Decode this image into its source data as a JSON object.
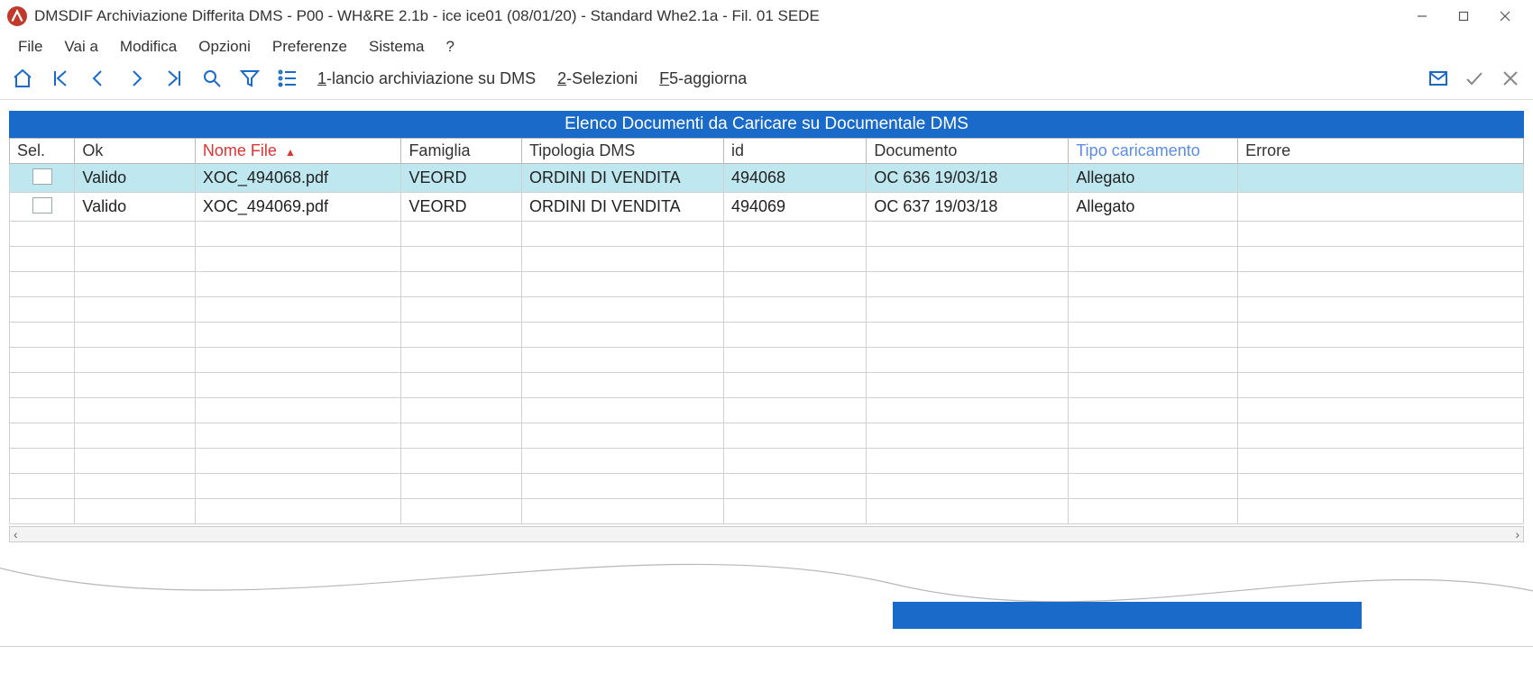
{
  "window": {
    "title": "DMSDIF  Archiviazione Differita DMS -  P00 - WH&RE  2.1b - ice  ice01 (08/01/20) - Standard Whe2.1a - Fil. 01 SEDE"
  },
  "menu": {
    "items": [
      "File",
      "Vai a",
      "Modifica",
      "Opzioni",
      "Preferenze",
      "Sistema",
      "?"
    ]
  },
  "toolbar": {
    "action1_prefix": "1",
    "action1_rest": "-lancio archiviazione su DMS",
    "action2_prefix": "2",
    "action2_rest": "-Selezioni",
    "action3_prefix": "F",
    "action3_rest": "5-aggiorna"
  },
  "panel": {
    "title": "Elenco Documenti da Caricare su Documentale DMS"
  },
  "table": {
    "headers": {
      "sel": "Sel.",
      "ok": "Ok",
      "nome_file": "Nome File",
      "famiglia": "Famiglia",
      "tipologia": "Tipologia DMS",
      "id": "id",
      "documento": "Documento",
      "tipo_caricamento": "Tipo caricamento",
      "errore": "Errore"
    },
    "sort_indicator": "▲",
    "rows": [
      {
        "ok": "Valido",
        "nome_file": "XOC_494068.pdf",
        "famiglia": "VEORD",
        "tipologia": "ORDINI DI VENDITA",
        "id": "494068",
        "documento": "OC 636 19/03/18",
        "tipo_caricamento": "Allegato",
        "errore": "",
        "selected": true
      },
      {
        "ok": "Valido",
        "nome_file": "XOC_494069.pdf",
        "famiglia": "VEORD",
        "tipologia": "ORDINI DI VENDITA",
        "id": "494069",
        "documento": "OC 637 19/03/18",
        "tipo_caricamento": "Allegato",
        "errore": "",
        "selected": false
      }
    ],
    "empty_rows": 12
  },
  "hscroll": {
    "left": "‹",
    "right": "›"
  }
}
